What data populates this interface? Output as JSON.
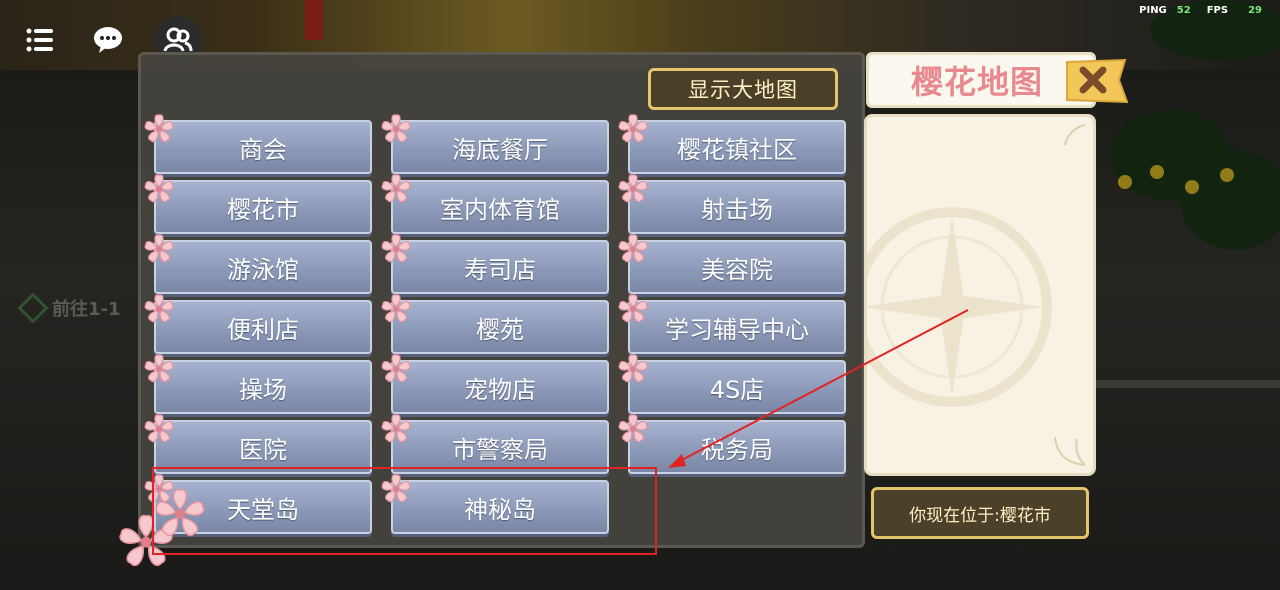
{
  "hud": {
    "ping_label": "PING",
    "ping_value": "52",
    "fps_label": "FPS",
    "fps_value": "29",
    "icons": [
      "menu-icon",
      "chat-icon",
      "friends-icon"
    ]
  },
  "background": {
    "quest_text": "前往1-1"
  },
  "map_panel": {
    "show_big_map_label": "显示大地图",
    "locations": [
      "商会",
      "海底餐厅",
      "樱花镇社区",
      "樱花市",
      "室内体育馆",
      "射击场",
      "游泳馆",
      "寿司店",
      "美容院",
      "便利店",
      "樱苑",
      "学习辅导中心",
      "操场",
      "宠物店",
      "4S店",
      "医院",
      "市警察局",
      "税务局",
      "天堂岛",
      "神秘岛"
    ]
  },
  "side_panel": {
    "title": "樱花地图",
    "current_location": "你现在位于:樱花市"
  },
  "colors": {
    "button_blue": "#8c99b8",
    "gold_border": "#e5c66c",
    "title_pink": "#e88990",
    "annotation_red": "#e02323"
  }
}
